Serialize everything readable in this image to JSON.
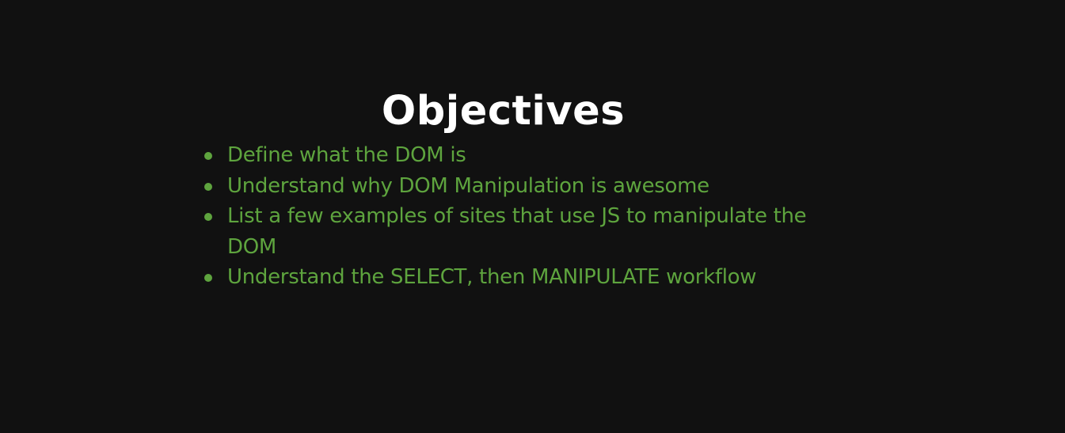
{
  "slide": {
    "title": "Objectives",
    "bullets": [
      "Define what the DOM is",
      "Understand why DOM Manipulation is awesome",
      "List a few examples of sites that use JS to manipulate the DOM",
      "Understand the SELECT, then MANIPULATE workflow"
    ]
  },
  "colors": {
    "background": "#111111",
    "title": "#ffffff",
    "bullet_text": "#5ea43e"
  }
}
